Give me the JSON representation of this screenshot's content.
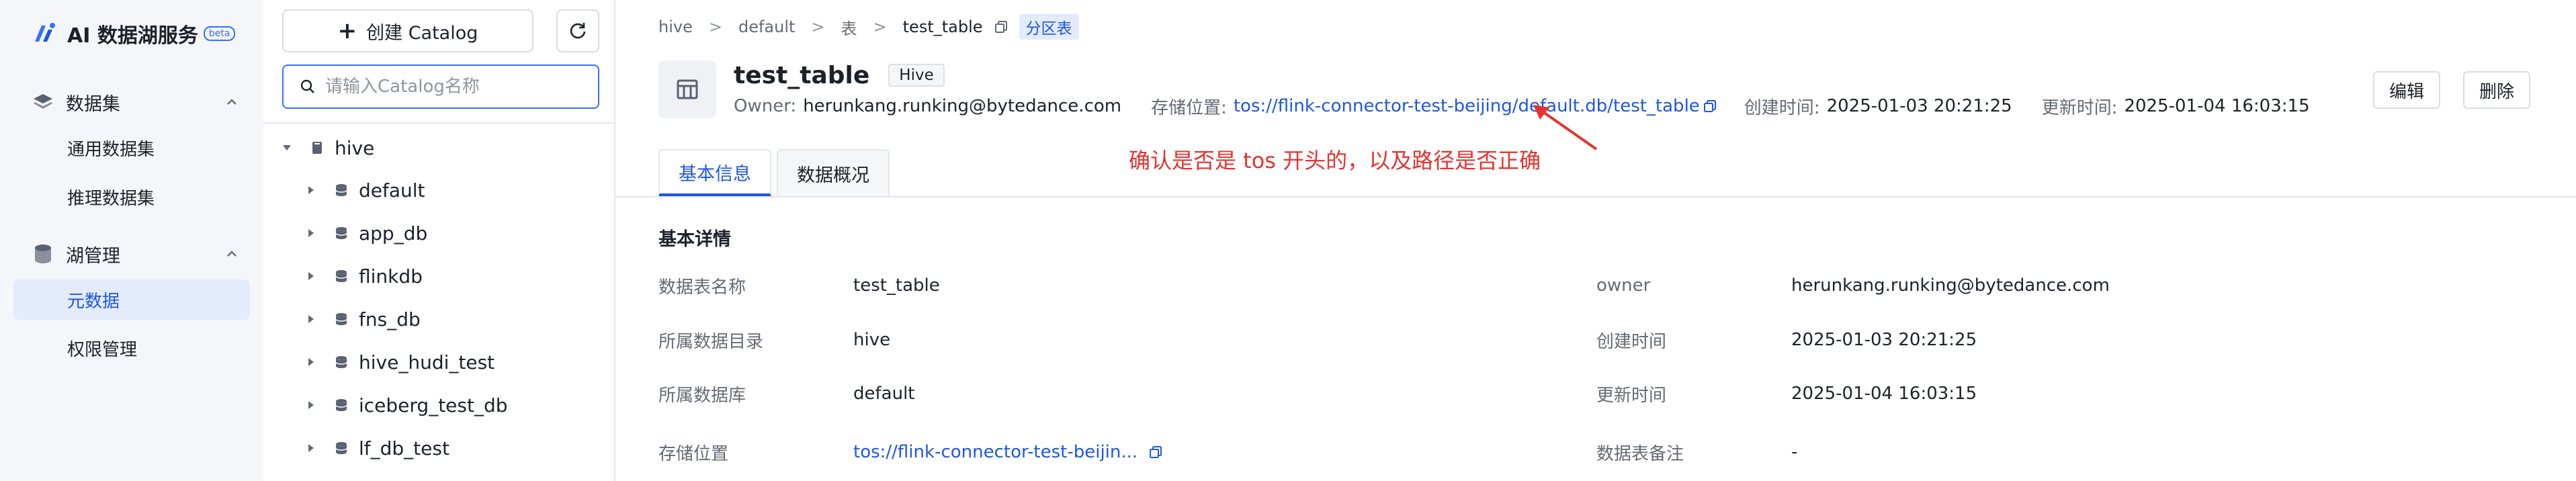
{
  "brand": {
    "title": "AI 数据湖服务",
    "beta": "beta"
  },
  "nav": {
    "groups": [
      {
        "label": "数据集",
        "items": [
          "通用数据集",
          "推理数据集"
        ]
      },
      {
        "label": "湖管理",
        "items": [
          "元数据",
          "权限管理"
        ]
      }
    ],
    "active_item": "元数据"
  },
  "catalog": {
    "create_label": "创建 Catalog",
    "search_placeholder": "请输入Catalog名称",
    "root": "hive",
    "databases": [
      "default",
      "app_db",
      "flinkdb",
      "fns_db",
      "hive_hudi_test",
      "iceberg_test_db",
      "lf_db_test"
    ]
  },
  "breadcrumb": {
    "items": [
      "hive",
      "default",
      "表",
      "test_table"
    ],
    "separator": ">",
    "tag": "分区表"
  },
  "table": {
    "name": "test_table",
    "type": "Hive",
    "owner_label": "Owner:",
    "owner": "herunkang.runking@bytedance.com",
    "location_label": "存储位置:",
    "location": "tos://flink-connector-test-beijing/default.db/test_table",
    "created_label": "创建时间:",
    "created": "2025-01-03 20:21:25",
    "updated_label": "更新时间:",
    "updated": "2025-01-04 16:03:15"
  },
  "actions": {
    "edit": "编辑",
    "delete": "删除"
  },
  "annotation": "确认是否是 tos 开头的，以及路径是否正确",
  "tabs": [
    "基本信息",
    "数据概况"
  ],
  "details": {
    "section_title": "基本详情",
    "left": [
      {
        "key": "数据表名称",
        "value": "test_table"
      },
      {
        "key": "所属数据目录",
        "value": "hive"
      },
      {
        "key": "所属数据库",
        "value": "default"
      },
      {
        "key": "存储位置",
        "value": "tos://flink-connector-test-beijin..."
      }
    ],
    "right": [
      {
        "key": "owner",
        "value": "herunkang.runking@bytedance.com"
      },
      {
        "key": "创建时间",
        "value": "2025-01-03 20:21:25"
      },
      {
        "key": "更新时间",
        "value": "2025-01-04 16:03:15"
      },
      {
        "key": "数据表备注",
        "value": "-"
      }
    ]
  },
  "colors": {
    "accent": "#1f56e0",
    "annotation": "#e5332f",
    "nav_bg": "#f4f6f9"
  }
}
